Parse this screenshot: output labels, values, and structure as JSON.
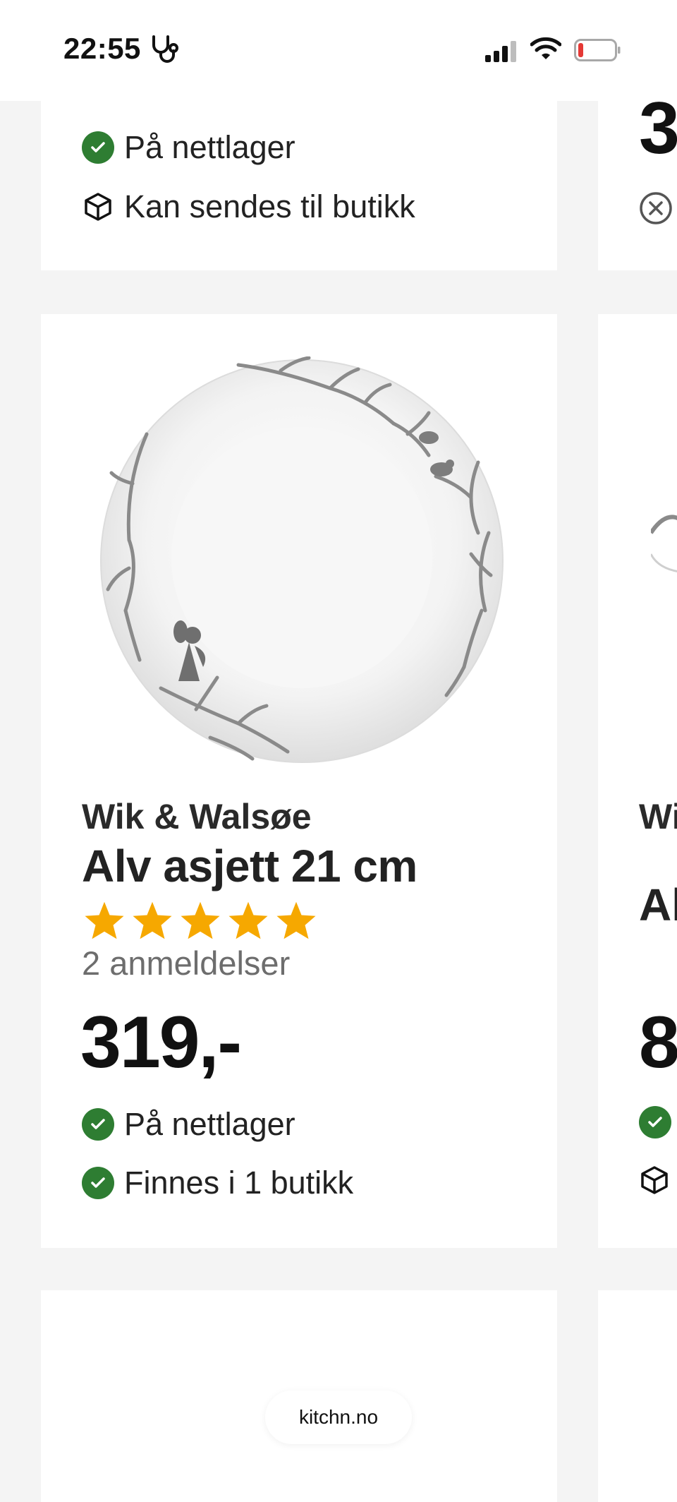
{
  "status_bar": {
    "time": "22:55",
    "icons": [
      "stethoscope-icon",
      "signal-icon",
      "wifi-icon",
      "battery-low-icon"
    ]
  },
  "previous_card": {
    "availability": [
      {
        "icon": "check-circle-icon",
        "text": "På nettlager"
      },
      {
        "icon": "box-icon",
        "text": "Kan sendes til butikk"
      }
    ]
  },
  "previous_card_right": {
    "price_fragment": "3",
    "status_icon": "close-circle-icon"
  },
  "product": {
    "image_alt": "white plate with grey branch and fairy illustration",
    "brand": "Wik & Walsøe",
    "title": "Alv asjett 21 cm",
    "rating": 5,
    "max_rating": 5,
    "reviews": "2 anmeldelser",
    "price": "319,-",
    "availability": [
      {
        "icon": "check-circle-icon",
        "text": "På nettlager"
      },
      {
        "icon": "check-circle-icon",
        "text": "Finnes i 1 butikk"
      }
    ]
  },
  "product_right_peek": {
    "brand_fragment": "Wi",
    "title_fragment": "Al",
    "price_fragment": "8",
    "icons": [
      "check-circle-icon",
      "box-icon"
    ]
  },
  "footer": {
    "site": "kitchn.no"
  },
  "colors": {
    "check_green": "#2e7d32",
    "star": "#f6a800",
    "background": "#f4f4f4",
    "card": "#ffffff"
  }
}
